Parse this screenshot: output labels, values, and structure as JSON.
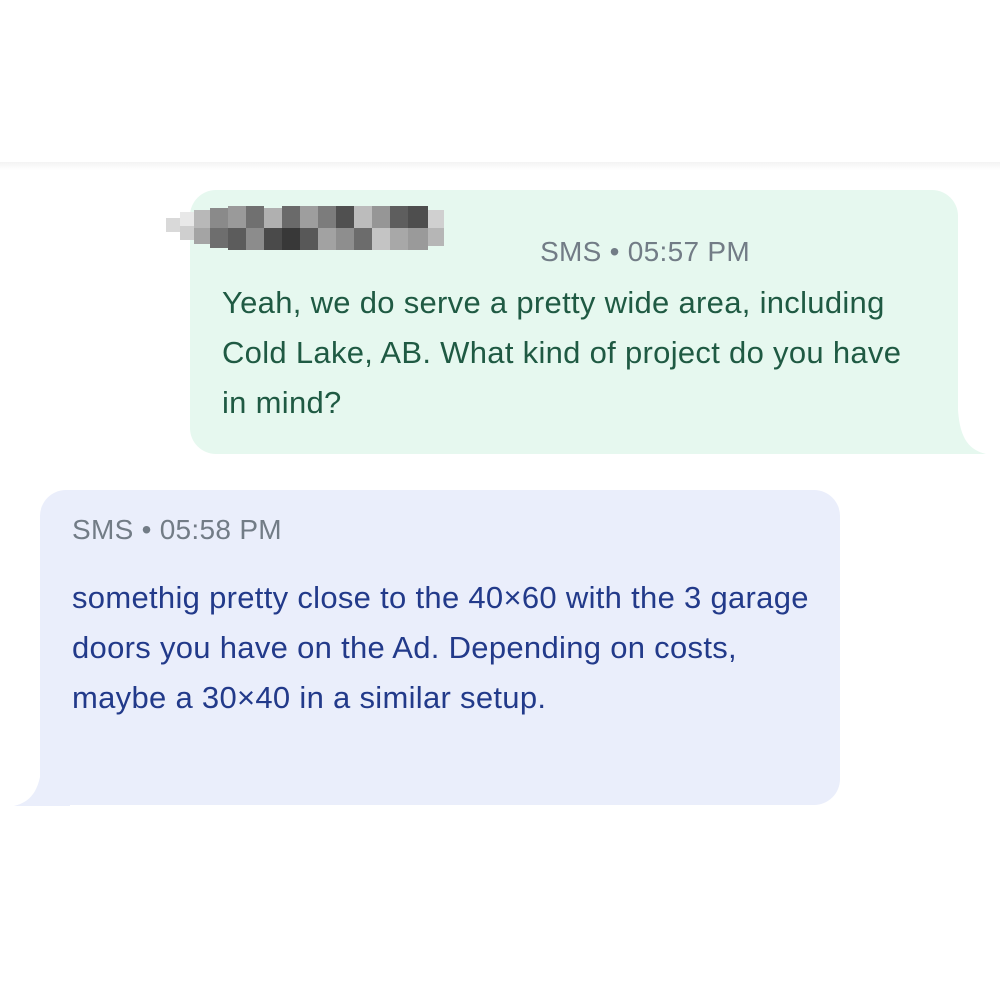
{
  "messages": [
    {
      "direction": "outgoing",
      "channel": "SMS",
      "separator": "•",
      "time": "05:57 PM",
      "sender_redacted": true,
      "text": "Yeah, we do serve a pretty wide area, including Cold Lake, AB. What kind of project do you have in mind?"
    },
    {
      "direction": "incoming",
      "channel": "SMS",
      "separator": "•",
      "time": "05:58 PM",
      "text": "somethig pretty close to the 40×60 with the 3 garage doors you have on the Ad. Depending on costs, maybe a 30×40 in a similar setup."
    }
  ],
  "colors": {
    "outgoing_bubble": "#e6f8ef",
    "outgoing_text": "#1f5a43",
    "incoming_bubble": "#eaeefb",
    "incoming_text": "#223a8a",
    "meta_text": "#727c86"
  }
}
